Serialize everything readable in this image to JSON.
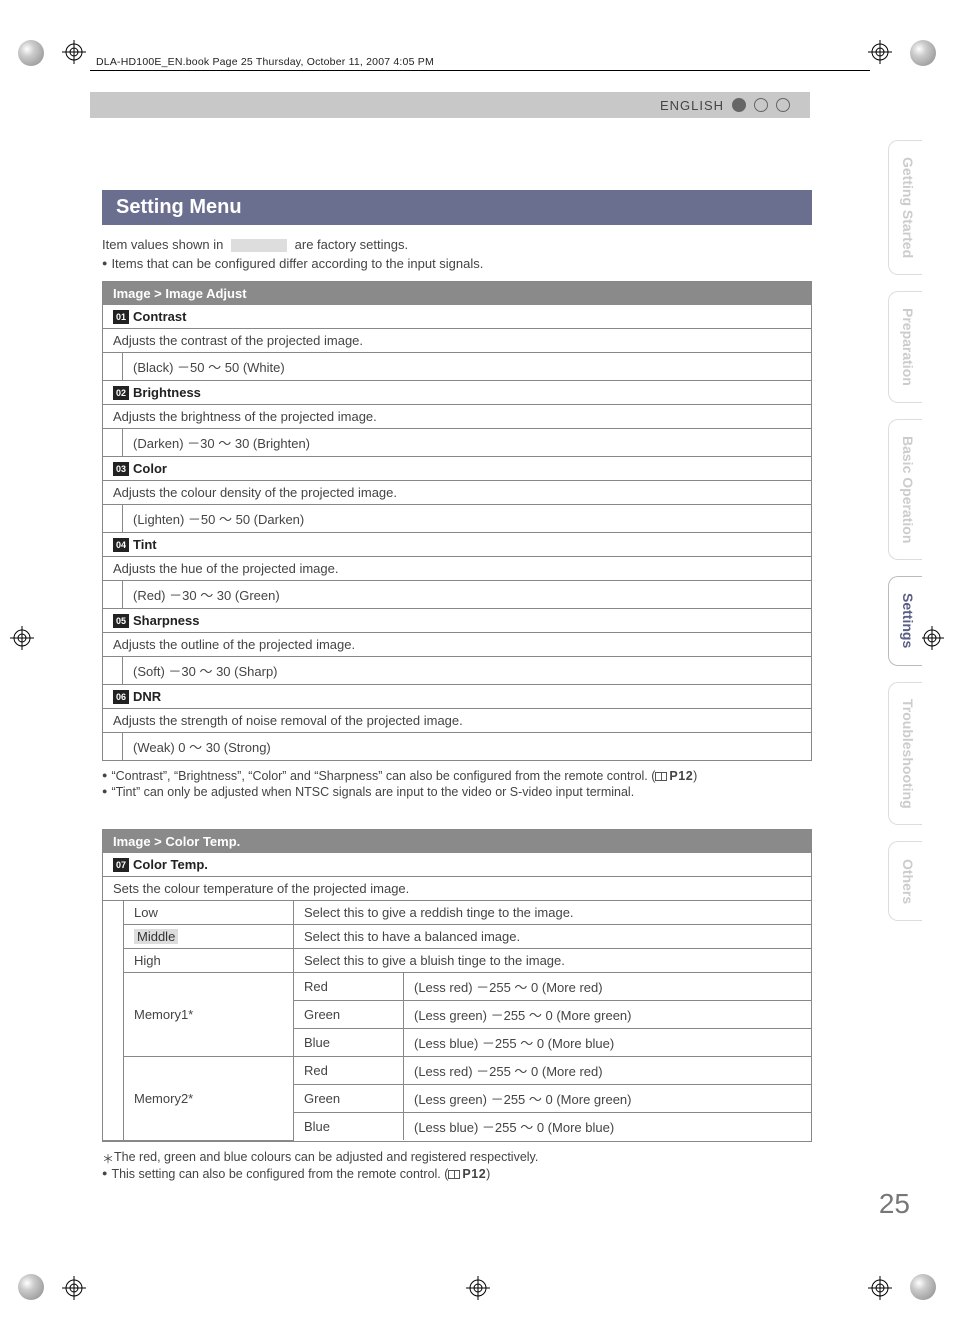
{
  "header_line": "DLA-HD100E_EN.book  Page 25  Thursday, October 11, 2007  4:05 PM",
  "language": "ENGLISH",
  "section_title": "Setting Menu",
  "intro": {
    "factory_prefix": "Item values shown in",
    "factory_suffix": "are factory settings.",
    "signals_note": "Items that can be configured differ according to the input signals."
  },
  "image_adjust": {
    "header": "Image > Image Adjust",
    "items": [
      {
        "num": "01",
        "title": "Contrast",
        "desc": "Adjusts the contrast of the projected image.",
        "range": "(Black) －50 ～ 50 (White)"
      },
      {
        "num": "02",
        "title": "Brightness",
        "desc": "Adjusts the brightness of the projected image.",
        "range": "(Darken) －30 ～ 30 (Brighten)"
      },
      {
        "num": "03",
        "title": "Color",
        "desc": "Adjusts the colour density of the projected image.",
        "range": "(Lighten) －50 ～ 50 (Darken)"
      },
      {
        "num": "04",
        "title": "Tint",
        "desc": "Adjusts the hue of the projected image.",
        "range": "(Red) －30 ～ 30 (Green)"
      },
      {
        "num": "05",
        "title": "Sharpness",
        "desc": "Adjusts the outline of the projected image.",
        "range": "(Soft) －30 ～ 30 (Sharp)"
      },
      {
        "num": "06",
        "title": "DNR",
        "desc": "Adjusts the strength of noise removal of the projected image.",
        "range": "(Weak) 0 ～ 30 (Strong)"
      }
    ],
    "footnotes": [
      "“Contrast”, “Brightness”, “Color” and “Sharpness” can also be configured from the remote control. (",
      "“Tint” can only be adjusted when NTSC signals are input to the video or S-video input terminal."
    ],
    "footnote_ref": "P12"
  },
  "color_temp": {
    "header": "Image > Color Temp.",
    "num": "07",
    "title": "Color Temp.",
    "desc": "Sets the colour temperature of the projected image.",
    "rows": {
      "low": {
        "label": "Low",
        "desc": "Select this to give a reddish tinge to the image."
      },
      "middle": {
        "label": "Middle",
        "desc": "Select this to have a balanced image."
      },
      "high": {
        "label": "High",
        "desc": "Select this to give a bluish tinge to the image."
      },
      "memory1": {
        "label": "Memory1*"
      },
      "memory2": {
        "label": "Memory2*"
      },
      "channels": {
        "red": {
          "label": "Red",
          "range": "(Less red) －255 ～ 0 (More red)"
        },
        "green": {
          "label": "Green",
          "range": "(Less green) －255 ～ 0 (More green)"
        },
        "blue": {
          "label": "Blue",
          "range": "(Less blue) －255 ～ 0 (More blue)"
        }
      }
    },
    "footnotes": {
      "ast": "The red, green and blue colours can be adjusted and registered respectively.",
      "remote": "This setting can also be configured from the remote control. (",
      "ref": "P12"
    }
  },
  "side_tabs": {
    "t1": "Getting Started",
    "t2": "Preparation",
    "t3": "Basic Operation",
    "t4": "Settings",
    "t5": "Troubleshooting",
    "t6": "Others"
  },
  "page_number": "25"
}
